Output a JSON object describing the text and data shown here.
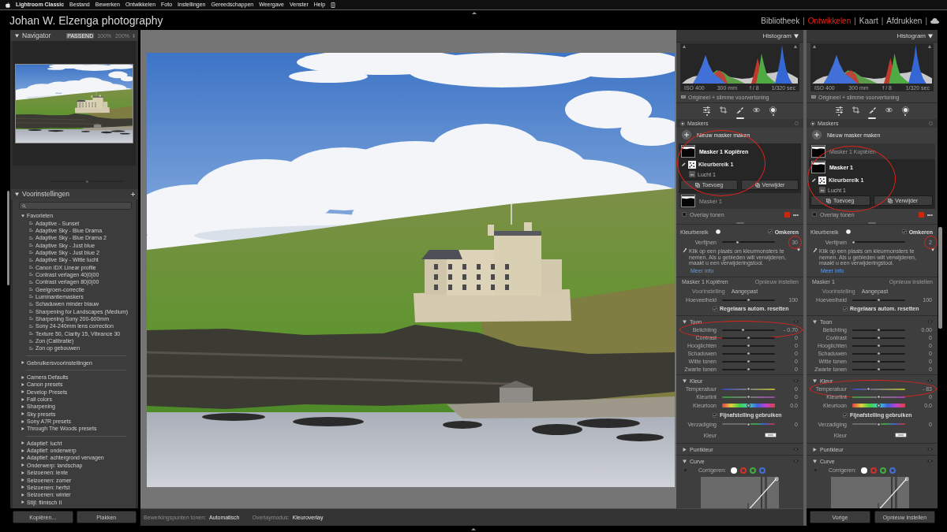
{
  "menu_bar": {
    "items": [
      {
        "label": "Lightroom Classic",
        "kind": "app"
      },
      {
        "label": "Bestand",
        "kind": "menu"
      },
      {
        "label": "Bewerken",
        "kind": "menu"
      },
      {
        "label": "Ontwikkelen",
        "kind": "menu"
      },
      {
        "label": "Foto",
        "kind": "menu"
      },
      {
        "label": "Instellingen",
        "kind": "menu"
      },
      {
        "label": "Gereedschappen",
        "kind": "menu"
      },
      {
        "label": "Weergave",
        "kind": "menu"
      },
      {
        "label": "Venster",
        "kind": "menu"
      },
      {
        "label": "Help",
        "kind": "menu"
      }
    ]
  },
  "identity_plate": "Johan W. Elzenga photography",
  "module_picker": {
    "separator": "|",
    "modules": [
      {
        "label": "Bibliotheek",
        "selected": false
      },
      {
        "label": "Ontwikkelen",
        "selected": true
      },
      {
        "label": "Kaart",
        "selected": false
      },
      {
        "label": "Afdrukken",
        "selected": false
      }
    ]
  },
  "navigator": {
    "title": "Navigator",
    "expanded": true,
    "zoom_options": [
      {
        "label": "PASSEND",
        "selected": true
      },
      {
        "label": "100%",
        "selected": false
      },
      {
        "label": "200%",
        "selected": false
      }
    ]
  },
  "faded_panel": {
    "disabled": true,
    "level": 0.52
  },
  "presets": {
    "title": "Voorinstellingen",
    "expanded": true,
    "sections": [
      {
        "groups": [
          {
            "label": "Favorieten",
            "expanded": true,
            "children": [
              {
                "label": "Adaptive - Sunset"
              },
              {
                "label": "Adaptive Sky - Blue Drama"
              },
              {
                "label": "Adaptive Sky - Blue Drama 2"
              },
              {
                "label": "Adaptive Sky - Just blue"
              },
              {
                "label": "Adaptive Sky - Just blue 2"
              },
              {
                "label": "Adaptive Sky - Witte lucht"
              },
              {
                "label": "Canon IDX Linear profile"
              },
              {
                "label": "Contrast verlagen 40|0|00"
              },
              {
                "label": "Contrast verlagen 80|0|00"
              },
              {
                "label": "Geelgroen-correctie"
              },
              {
                "label": "Luminantiemaskers"
              },
              {
                "label": "Schaduwen minder blauw"
              },
              {
                "label": "Sharpening for Landscapes (Medium)"
              },
              {
                "label": "Sharpening Sony 200-600mm"
              },
              {
                "label": "Sony 24-240mm lens correction"
              },
              {
                "label": "Texture 50, Clarity 15, Vibrance 30"
              },
              {
                "label": "Zon (Calibratie)"
              },
              {
                "label": "Zon op gebouwen"
              }
            ]
          }
        ]
      },
      {
        "groups": [
          {
            "label": "Gebruikersvoorinstellingen",
            "expanded": false
          }
        ]
      },
      {
        "groups": [
          {
            "label": "Camera Defaults",
            "expanded": false
          },
          {
            "label": "Canon presets",
            "expanded": false
          },
          {
            "label": "Develop Presets",
            "expanded": false
          },
          {
            "label": "Fall colors",
            "expanded": false
          },
          {
            "label": "Sharpening",
            "expanded": false
          },
          {
            "label": "Sky presets",
            "expanded": false
          },
          {
            "label": "Sony A7R presets",
            "expanded": false
          },
          {
            "label": "Through The Woods presets",
            "expanded": false
          }
        ]
      },
      {
        "groups": [
          {
            "label": "Adaptief: lucht",
            "expanded": false
          },
          {
            "label": "Adaptief: onderwerp",
            "expanded": false
          },
          {
            "label": "Adaptief: achtergrond vervagen",
            "expanded": false
          },
          {
            "label": "Onderwerp: landschap",
            "expanded": false
          },
          {
            "label": "Seizoenen: lente",
            "expanded": false
          },
          {
            "label": "Seizoenen: zomer",
            "expanded": false
          },
          {
            "label": "Seizoenen: herfst",
            "expanded": false
          },
          {
            "label": "Seizoenen: winter",
            "expanded": false
          },
          {
            "label": "Stijl: filmisch II",
            "expanded": false
          }
        ]
      }
    ]
  },
  "left_buttons": [
    "Kopiëren...",
    "Plakken"
  ],
  "toolbar": {
    "items": [
      {
        "label": "Bewerkingspunten tonen:",
        "value": "Automatisch"
      },
      {
        "label": "Overlaymodus:",
        "value": "Kleuroverlay"
      }
    ]
  },
  "panels": [
    {
      "histogram": {
        "title": "Histogram",
        "expanded": true,
        "info": [
          "ISO 400",
          "300 mm",
          "f / 8",
          "1/320 sec"
        ],
        "preview": "Origineel + slimme voorvertoning"
      },
      "tools": [
        {
          "kind": "edit",
          "indicator": true
        },
        {
          "kind": "crop",
          "indicator": false
        },
        {
          "kind": "heal",
          "indicator": false
        },
        {
          "kind": "redeye",
          "indicator": false
        },
        {
          "kind": "mask",
          "indicator": true
        }
      ],
      "masks": {
        "title": "Maskers",
        "new_label": "Nieuw masker maken",
        "items": [
          {
            "name": "Masker 1 Kopiëren",
            "selected": true,
            "circled": true,
            "components": [
              {
                "kind": "color_range",
                "name": "Kleurbereik 1"
              },
              {
                "kind": "sky",
                "name": "Lucht 1"
              }
            ]
          },
          {
            "name": "Masker 1",
            "selected": false,
            "circled": false
          }
        ],
        "buttons": [
          "Toevoeg",
          "Verwijder"
        ],
        "overlay": {
          "label": "Overlay tonen",
          "checked": false,
          "color": "#c8280f"
        },
        "more": "•••"
      },
      "color_range": {
        "title": "Kleurbereik",
        "invert": {
          "label": "Omkeren",
          "checked": true
        },
        "refine": {
          "label": "Verfijnen",
          "level": 0.3,
          "value": "30",
          "circled": true
        },
        "hint": "Klik op een plaats om kleurmonsters te nemen. Als u gebieden wilt verwijderen, maakt u een verwijderingstool.",
        "link": "Meer info"
      },
      "mask_settings": {
        "title": "Masker 1 Kopiëren",
        "reset": "Opnieuw instellen",
        "preset_label": "Voorinstelling",
        "preset_value": "Aangepast",
        "items": [
          {
            "kind": "slider",
            "label": "Hoeveelheid",
            "level": 0.5,
            "value": "100",
            "circled": false
          },
          {
            "kind": "checkbox",
            "label": "Regelaars autom. resetten",
            "checked": true
          }
        ]
      },
      "sections": [
        {
          "kind": "adjustments",
          "title": "Toon",
          "expanded": true,
          "items": [
            {
              "kind": "slider",
              "label": "Belichting",
              "level": 0.41,
              "value": "- 0.70",
              "circled": true
            },
            {
              "kind": "slider",
              "label": "Contrast",
              "level": 0.5,
              "value": "0",
              "circled": false
            },
            {
              "kind": "slider",
              "label": "Hooglichten",
              "level": 0.5,
              "value": "0",
              "circled": false
            },
            {
              "kind": "slider",
              "label": "Schaduwen",
              "level": 0.5,
              "value": "0",
              "circled": false
            },
            {
              "kind": "slider",
              "label": "Witte tonen",
              "level": 0.5,
              "value": "0",
              "circled": false
            },
            {
              "kind": "slider",
              "label": "Zwarte tonen",
              "level": 0.5,
              "value": "0",
              "circled": false
            }
          ]
        },
        {
          "kind": "adjustments",
          "title": "Kleur",
          "expanded": true,
          "items": [
            {
              "kind": "temperature",
              "label": "Temperatuur",
              "level": 0.5,
              "value": "0",
              "circled": false
            },
            {
              "kind": "tint",
              "label": "Kleurtint",
              "level": 0.5,
              "value": "0",
              "circled": false
            },
            {
              "kind": "hue",
              "label": "Kleurtoon",
              "level": 0.5,
              "value": "0.0",
              "circled": false
            },
            {
              "kind": "checkbox",
              "label": "Fijnafstelling gebruiken",
              "checked": true
            },
            {
              "kind": "saturation",
              "label": "Verzadiging",
              "level": 0.5,
              "value": "0",
              "circled": false
            },
            {
              "kind": "swatch",
              "label": "Kleur"
            }
          ]
        },
        {
          "kind": "adjustments",
          "title": "Puntkleur",
          "expanded": false
        },
        {
          "kind": "curve",
          "title": "Curve",
          "expanded": true,
          "channel_label": "Corrigeren:",
          "channels": [
            {
              "color": "#ffffff",
              "selected": true
            },
            {
              "color": "#d2302a",
              "selected": false
            },
            {
              "color": "#3fae3f",
              "selected": false
            },
            {
              "color": "#3f6fd8",
              "selected": false
            }
          ]
        }
      ]
    },
    {
      "histogram": {
        "title": "Histogram",
        "expanded": true,
        "info": [
          "ISO 400",
          "300 mm",
          "f / 8",
          "1/320 sec"
        ],
        "preview": "Origineel + slimme voorvertoning"
      },
      "tools": [
        {
          "kind": "edit",
          "indicator": true
        },
        {
          "kind": "crop",
          "indicator": false
        },
        {
          "kind": "heal",
          "indicator": false
        },
        {
          "kind": "redeye",
          "indicator": false
        },
        {
          "kind": "mask",
          "indicator": true
        }
      ],
      "masks": {
        "title": "Maskers",
        "new_label": "Nieuw masker maken",
        "items": [
          {
            "name": "Masker 1 Kopiëren",
            "selected": false,
            "circled": false
          },
          {
            "name": "Masker 1",
            "selected": true,
            "circled": true,
            "components": [
              {
                "kind": "color_range",
                "name": "Kleurbereik 1"
              },
              {
                "kind": "sky",
                "name": "Lucht 1"
              }
            ]
          }
        ],
        "buttons": [
          "Toevoeg",
          "Verwijder"
        ],
        "overlay": {
          "label": "Overlay tonen",
          "checked": false,
          "color": "#c8280f"
        },
        "more": "•••"
      },
      "color_range": {
        "title": "Kleurbereik",
        "invert": {
          "label": "Omkeren",
          "checked": true
        },
        "refine": {
          "label": "Verfijnen",
          "level": 0.03,
          "value": "2",
          "circled": true
        },
        "hint": "Klik op een plaats om kleurmonsters te nemen. Als u gebieden wilt verwijderen, maakt u een verwijderingstool.",
        "link": "Meer info"
      },
      "mask_settings": {
        "title": "Masker 1",
        "reset": "Opnieuw instellen",
        "preset_label": "Voorinstelling",
        "preset_value": "Aangepast",
        "items": [
          {
            "kind": "slider",
            "label": "Hoeveelheid",
            "level": 0.5,
            "value": "100",
            "circled": false
          },
          {
            "kind": "checkbox",
            "label": "Regelaars autom. resetten",
            "checked": true
          }
        ]
      },
      "sections": [
        {
          "kind": "adjustments",
          "title": "Toon",
          "expanded": true,
          "items": [
            {
              "kind": "slider",
              "label": "Belichting",
              "level": 0.5,
              "value": "0.00",
              "circled": false
            },
            {
              "kind": "slider",
              "label": "Contrast",
              "level": 0.5,
              "value": "0",
              "circled": false
            },
            {
              "kind": "slider",
              "label": "Hooglichten",
              "level": 0.5,
              "value": "0",
              "circled": false
            },
            {
              "kind": "slider",
              "label": "Schaduwen",
              "level": 0.5,
              "value": "0",
              "circled": false
            },
            {
              "kind": "slider",
              "label": "Witte tonen",
              "level": 0.5,
              "value": "0",
              "circled": false
            },
            {
              "kind": "slider",
              "label": "Zwarte tonen",
              "level": 0.5,
              "value": "0",
              "circled": false
            }
          ]
        },
        {
          "kind": "adjustments",
          "title": "Kleur",
          "expanded": true,
          "items": [
            {
              "kind": "temperature",
              "label": "Temperatuur",
              "level": 0.32,
              "value": "- 83",
              "circled": true
            },
            {
              "kind": "tint",
              "label": "Kleurtint",
              "level": 0.5,
              "value": "0",
              "circled": false
            },
            {
              "kind": "hue",
              "label": "Kleurtoon",
              "level": 0.5,
              "value": "0.0",
              "circled": false
            },
            {
              "kind": "checkbox",
              "label": "Fijnafstelling gebruiken",
              "checked": true
            },
            {
              "kind": "saturation",
              "label": "Verzadiging",
              "level": 0.5,
              "value": "0",
              "circled": false
            },
            {
              "kind": "swatch",
              "label": "Kleur"
            }
          ]
        },
        {
          "kind": "adjustments",
          "title": "Puntkleur",
          "expanded": false
        },
        {
          "kind": "curve",
          "title": "Curve",
          "expanded": true,
          "channel_label": "Corrigeren:",
          "channels": [
            {
              "color": "#ffffff",
              "selected": true
            },
            {
              "color": "#d2302a",
              "selected": false
            },
            {
              "color": "#3fae3f",
              "selected": false
            },
            {
              "color": "#3f6fd8",
              "selected": false
            }
          ]
        }
      ]
    }
  ],
  "right_buttons": [
    "Vorige",
    "Opnieuw instellen"
  ]
}
